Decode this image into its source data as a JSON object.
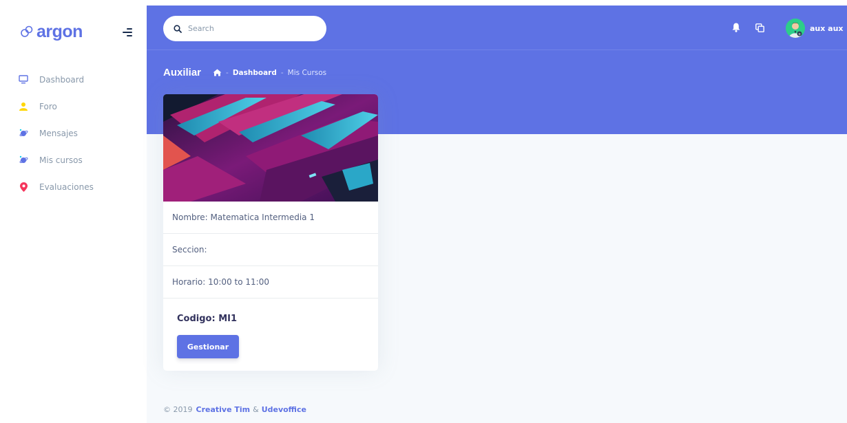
{
  "brand": {
    "name": "argon",
    "color": "#5e72e4"
  },
  "sidebar": {
    "items": [
      {
        "label": "Dashboard",
        "icon": "tv-icon",
        "color": "#5e72e4"
      },
      {
        "label": "Foro",
        "icon": "user-icon",
        "color": "#ffd600"
      },
      {
        "label": "Mensajes",
        "icon": "planet-icon",
        "color": "#5e72e4"
      },
      {
        "label": "Mis cursos",
        "icon": "planet-icon",
        "color": "#5e72e4"
      },
      {
        "label": "Evaluaciones",
        "icon": "pin-icon",
        "color": "#f5365c"
      }
    ]
  },
  "search": {
    "placeholder": "Search"
  },
  "user": {
    "name": "aux aux"
  },
  "header": {
    "title": "Auxiliar",
    "breadcrumb": [
      "Dashboard",
      "Mis Cursos"
    ]
  },
  "course": {
    "nombre": "Nombre: Matematica Intermedia 1",
    "seccion": "Seccion:",
    "horario": "Horario: 10:00 to 11:00",
    "codigo": "Codigo: MI1",
    "button": "Gestionar"
  },
  "footer": {
    "prefix": "© 2019",
    "link1": "Creative Tim",
    "amp": "&",
    "link2": "Udevoffice"
  },
  "colors": {
    "primary": "#5e72e4",
    "background": "#f6f9fc",
    "text": "#525f7f",
    "muted": "#8898aa"
  }
}
